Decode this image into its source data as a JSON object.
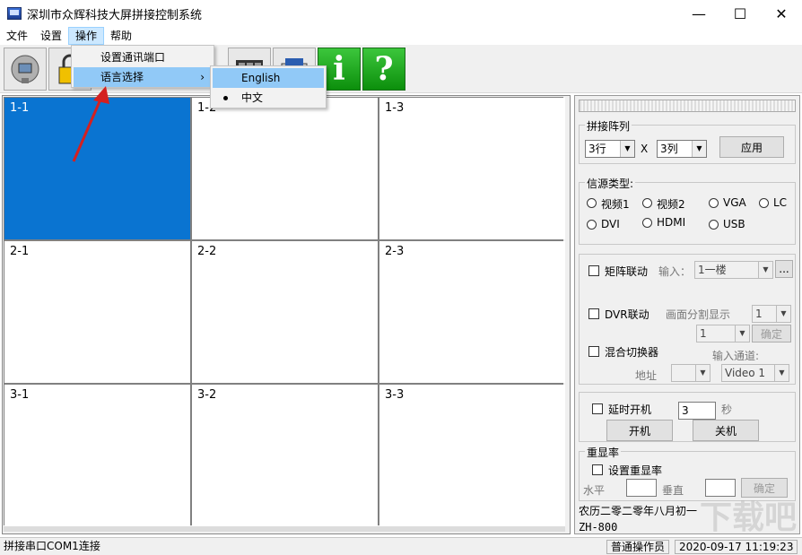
{
  "window": {
    "title": "深圳市众辉科技大屏拼接控制系统",
    "min": "—",
    "max": "☐",
    "close": "✕"
  },
  "menu": [
    "文件",
    "设置",
    "操作",
    "帮助"
  ],
  "dropdown": {
    "items": [
      "设置通讯端口",
      "语言选择"
    ],
    "submenu_arrow": "›"
  },
  "submenu": {
    "items": [
      "English",
      "中文"
    ],
    "checked_index": 1
  },
  "toolbar": {
    "info_label": "i",
    "help_label": "?"
  },
  "grid": {
    "cells": [
      "1-1",
      "1-2",
      "1-3",
      "2-1",
      "2-2",
      "2-3",
      "3-1",
      "3-2",
      "3-3"
    ],
    "selected": "1-1"
  },
  "panel": {
    "splice": {
      "title": "拼接阵列",
      "rows": "3行",
      "times": "X",
      "cols": "3列",
      "apply": "应用"
    },
    "source": {
      "title": "信源类型:",
      "options": [
        "视频1",
        "视频2",
        "VGA",
        "LC",
        "DVI",
        "HDMI",
        "USB"
      ]
    },
    "matrix": {
      "matrix_label": "矩阵联动",
      "input_label": "输入：",
      "input_value": "1一楼",
      "ellipsis": "...",
      "dvr_label": "DVR联动",
      "split_label": "画面分割显示",
      "split_value": "1",
      "sub_value": "1",
      "confirm": "确定",
      "mixer_label": "混合切换器",
      "channel_label": "输入通道:",
      "address_label": "地址",
      "address_value": "",
      "channel_value": "Video 1"
    },
    "timer": {
      "label": "延时开机",
      "value": "3",
      "unit": "秒",
      "on": "开机",
      "off": "关机"
    },
    "refresh": {
      "title": "重显率",
      "label": "设置重显率",
      "h_label": "水平",
      "v_label": "垂直",
      "confirm": "确定"
    },
    "lunar": "农历二零二零年八月初一",
    "model": "ZH-800"
  },
  "status": {
    "connection": "拼接串口COM1连接",
    "user": "普通操作员",
    "datetime": "2020-09-17 11:19:23"
  },
  "watermark": "下载吧"
}
